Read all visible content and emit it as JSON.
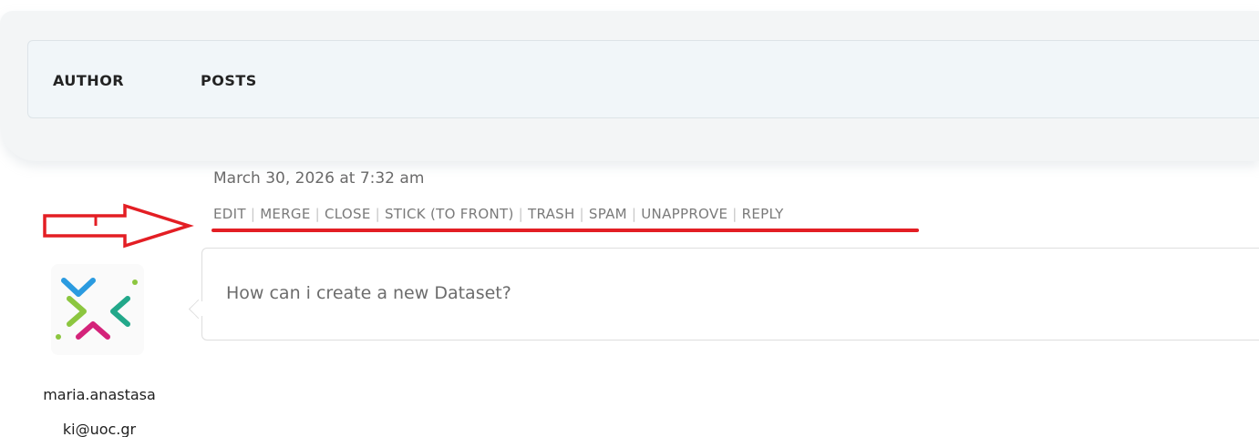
{
  "header": {
    "author_label": "AUTHOR",
    "posts_label": "POSTS"
  },
  "post": {
    "date": "March 30, 2026 at 7:32 am",
    "actions": [
      "EDIT",
      "MERGE",
      "CLOSE",
      "STICK (TO FRONT)",
      "TRASH",
      "SPAM",
      "UNAPPROVE",
      "REPLY"
    ],
    "separator": "|",
    "content": "How can i create a new Dataset?",
    "author_name_line1": "maria.anastasa",
    "author_name_line2": "ki@uoc.gr"
  },
  "annotation": {
    "color": "#e31e24"
  },
  "logo_colors": {
    "blue": "#2b9be0",
    "green": "#8cc63f",
    "teal": "#22a88a",
    "pink": "#d4237a"
  }
}
